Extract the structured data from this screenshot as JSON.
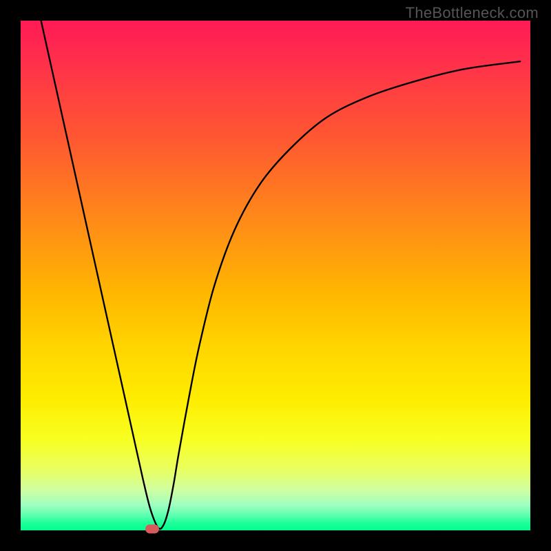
{
  "watermark": "TheBottleneck.com",
  "chart_data": {
    "type": "line",
    "title": "",
    "xlabel": "",
    "ylabel": "",
    "xlim": [
      0,
      100
    ],
    "ylim": [
      0,
      100
    ],
    "grid": false,
    "series": [
      {
        "name": "curve",
        "x": [
          4,
          6,
          8,
          10,
          12,
          14,
          16,
          18,
          20,
          22,
          24,
          25.5,
          27,
          28,
          29,
          30,
          31,
          33,
          35,
          38,
          42,
          47,
          53,
          60,
          68,
          77,
          87,
          98
        ],
        "y": [
          100,
          91,
          82,
          73,
          64,
          55,
          46,
          37,
          28,
          19,
          10,
          4,
          0.5,
          1,
          4,
          9,
          15,
          26,
          36,
          48,
          59,
          68,
          75,
          81,
          85,
          88,
          90.5,
          92
        ]
      }
    ],
    "marker": {
      "x": 25.8,
      "y": 0.3
    },
    "colors": {
      "gradient_top": "#ff1a55",
      "gradient_bottom": "#00ff90",
      "curve": "#000000",
      "marker": "#d85a5a",
      "frame": "#000000"
    }
  }
}
